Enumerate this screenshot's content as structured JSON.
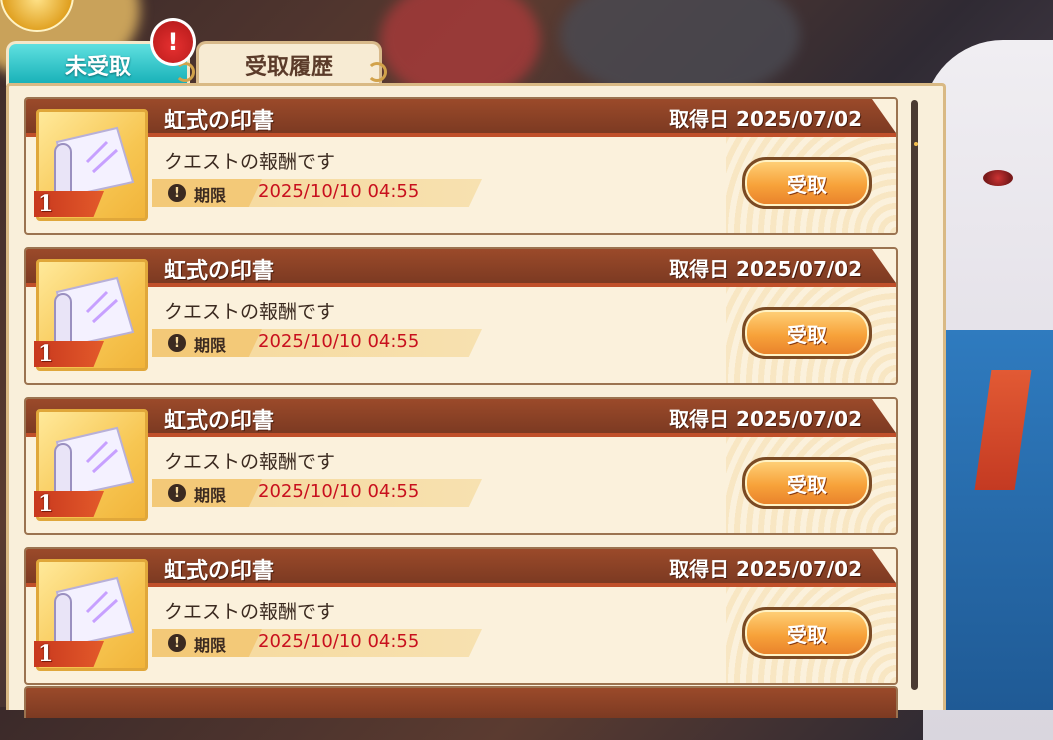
{
  "tabs": [
    {
      "label": "未受取",
      "active": true
    },
    {
      "label": "受取履歴",
      "active": false
    }
  ],
  "alert_badge": "!",
  "items": [
    {
      "name": "虹式の印書",
      "date_label": "取得日 2025/07/02",
      "description": "クエストの報酬です",
      "quantity": "1",
      "deadline_label": "期限",
      "deadline": "2025/10/10 04:55",
      "claim_label": "受取"
    },
    {
      "name": "虹式の印書",
      "date_label": "取得日 2025/07/02",
      "description": "クエストの報酬です",
      "quantity": "1",
      "deadline_label": "期限",
      "deadline": "2025/10/10 04:55",
      "claim_label": "受取"
    },
    {
      "name": "虹式の印書",
      "date_label": "取得日 2025/07/02",
      "description": "クエストの報酬です",
      "quantity": "1",
      "deadline_label": "期限",
      "deadline": "2025/10/10 04:55",
      "claim_label": "受取"
    },
    {
      "name": "虹式の印書",
      "date_label": "取得日 2025/07/02",
      "description": "クエストの報酬です",
      "quantity": "1",
      "deadline_label": "期限",
      "deadline": "2025/10/10 04:55",
      "claim_label": "受取"
    }
  ],
  "colors": {
    "tab_active": "#14aeb6",
    "header": "#7c3a22",
    "deadline_text": "#c8101e",
    "button": "#f7a23a"
  },
  "icons": {
    "item": "scroll-icon",
    "warning": "warning-icon"
  }
}
